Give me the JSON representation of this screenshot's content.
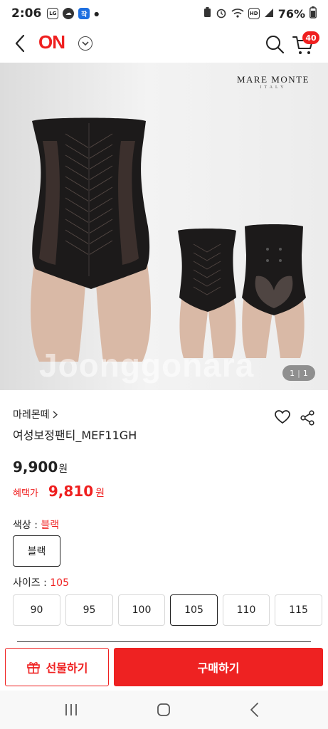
{
  "status_bar": {
    "time": "2:06",
    "chip_blue": "작",
    "chip_hd": "HD",
    "battery": "76%",
    "icons": [
      "notification-icon",
      "cloud-chat-icon",
      "app-icon",
      "dot-icon",
      "battery-saver-icon",
      "alarm-icon",
      "wifi-icon",
      "hd-voice-icon",
      "signal-icon",
      "battery-icon"
    ]
  },
  "header": {
    "logo": "ON",
    "cart_count": "40",
    "icons": [
      "back-arrow-icon",
      "chevron-down-icon",
      "search-icon",
      "cart-icon"
    ]
  },
  "product_image": {
    "brand_main": "MARE MONTE",
    "brand_sub": "ITALY",
    "watermark": "Joonggonara",
    "current": "1",
    "total": "1"
  },
  "product": {
    "brand_name": "마레몬떼",
    "title": "여성보정팬티_MEF11GH",
    "price": "9,900",
    "price_unit": "원",
    "benefit_label": "혜택가",
    "benefit_price": "9,810",
    "benefit_unit": "원"
  },
  "options": {
    "color_label": "색상 :",
    "color_value": "블랙",
    "colors": [
      "블랙"
    ],
    "size_label": "사이즈 :",
    "size_value": "105",
    "sizes": [
      "90",
      "95",
      "100",
      "105",
      "110",
      "115"
    ],
    "selected_size": "105"
  },
  "actions": {
    "gift_label": "선물하기",
    "buy_label": "구매하기"
  },
  "colors": {
    "brand_red": "#ef1f1f",
    "text": "#222222"
  }
}
